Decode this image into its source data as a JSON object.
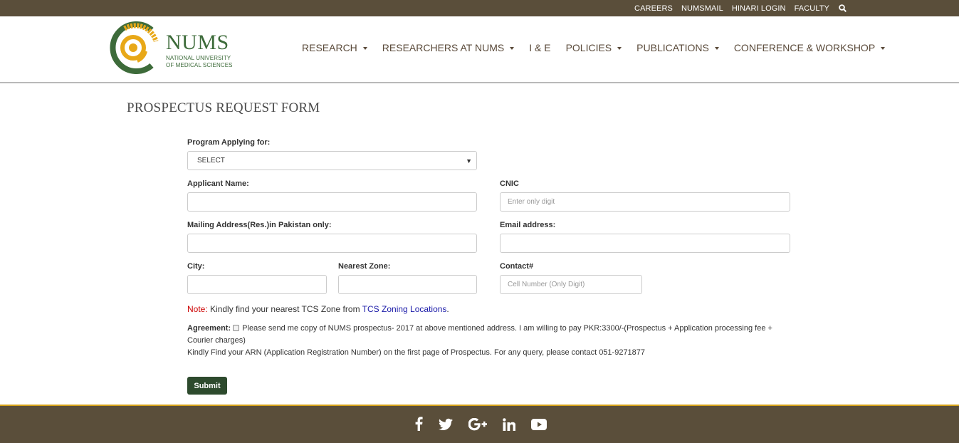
{
  "topbar": {
    "links": [
      "CAREERS",
      "NUMSMAIL",
      "HINARI LOGIN",
      "FACULTY"
    ],
    "search_icon": "search-icon"
  },
  "logo": {
    "brand": "NUMS",
    "line1": "NATIONAL UNIVERSITY",
    "line2": "OF MEDICAL SCIENCES"
  },
  "nav": {
    "items": [
      "RESEARCH",
      "RESEARCHERS AT NUMS",
      "I & E",
      "POLICIES",
      "PUBLICATIONS",
      "CONFERENCE & WORKSHOP"
    ]
  },
  "page": {
    "title": "PROSPECTUS REQUEST FORM"
  },
  "form": {
    "program_label": "Program Applying for:",
    "program_selected": "SELECT",
    "name_label": "Applicant Name:",
    "name_value": "",
    "cnic_label": "CNIC",
    "cnic_placeholder": "Enter only digit",
    "address_label": "Mailing Address(Res.)in Pakistan only:",
    "address_value": "",
    "email_label": "Email address:",
    "email_value": "",
    "city_label": "City:",
    "city_value": "",
    "zone_label": "Nearest Zone:",
    "zone_value": "",
    "contact_label": "Contact#",
    "contact_placeholder": "Cell Number (Only Digit)",
    "note_prefix": "Note:",
    "note_text": " Kindly find your nearest TCS Zone from ",
    "note_link": "TCS Zoning Locations",
    "note_suffix": ".",
    "agreement_label": "Agreement:",
    "agreement_text": " Please send me copy of NUMS prospectus- 2017 at above mentioned address. I am willing to pay PKR:3300/-(Prospectus + Application processing fee + Courier charges)",
    "agreement_line2": "Kindly Find your ARN (Application Registration Number) on the first page of Prospectus. For any query, please contact 051-9271877",
    "submit_label": "Submit"
  },
  "footer": {
    "social_icons": [
      "facebook-icon",
      "twitter-icon",
      "google-plus-icon",
      "linkedin-icon",
      "youtube-icon"
    ]
  },
  "colors": {
    "brand_brown": "#5a4e3a",
    "brand_green": "#3d6b3a",
    "accent_gold": "#d4a017",
    "submit_green": "#2d4a2d"
  }
}
